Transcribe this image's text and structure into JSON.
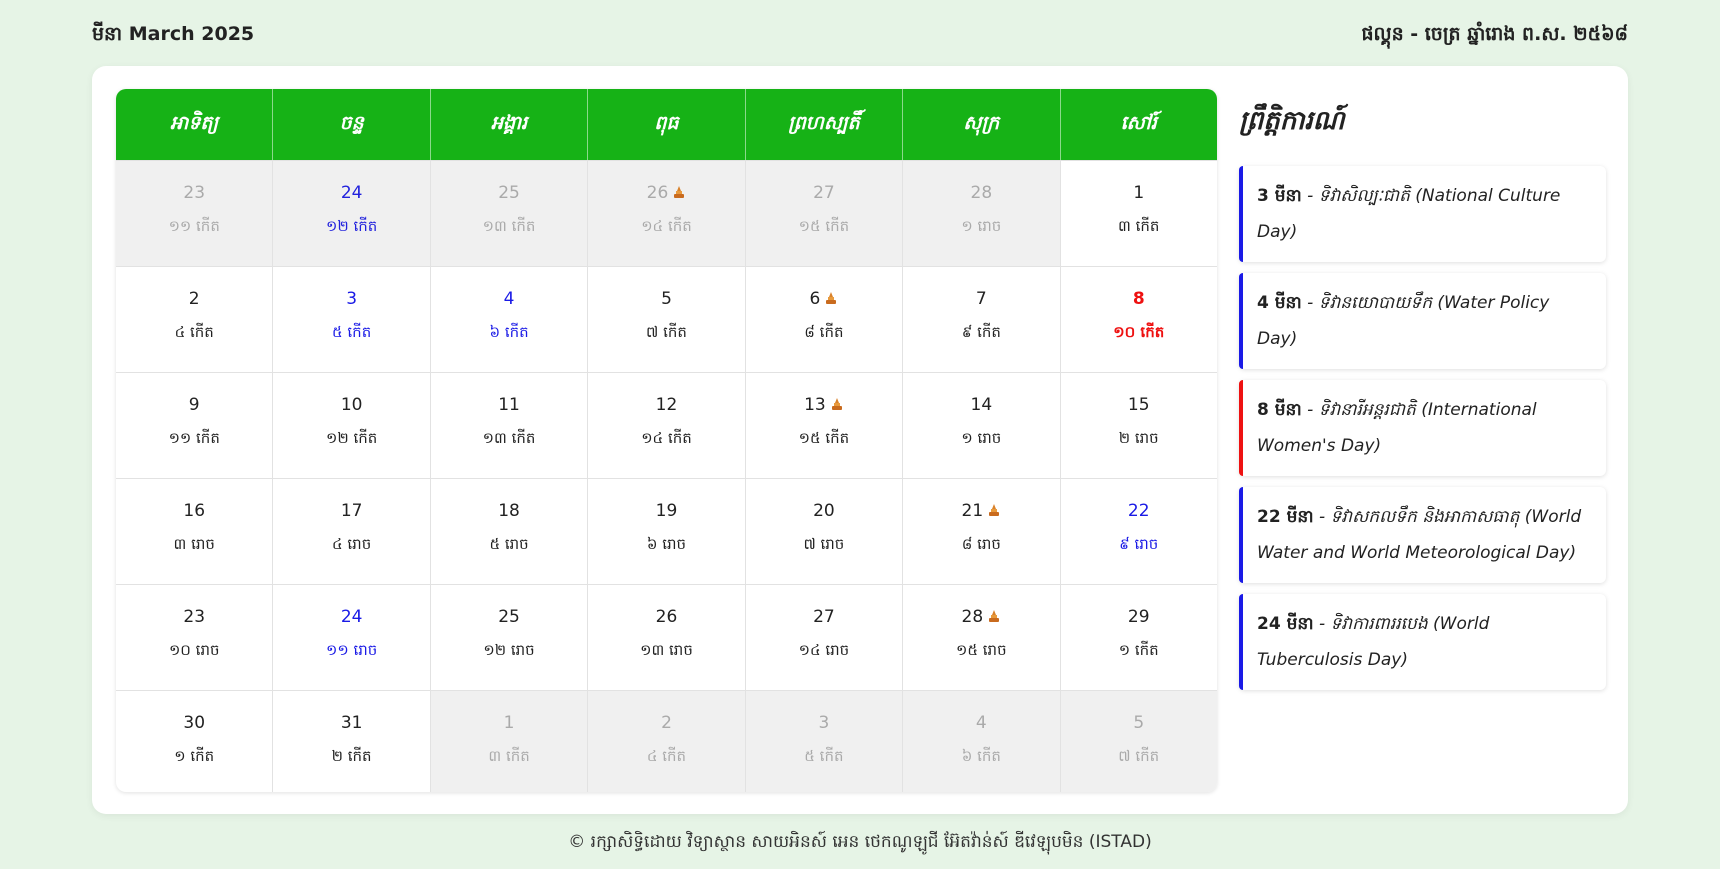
{
  "header": {
    "month_title": "មីនា March 2025",
    "lunar_title": "ផល្គុន - ចេត្រ ឆ្នាំរោង ព.ស. ២៥៦៨"
  },
  "weekdays": [
    "អាទិត្យ",
    "ចន្ទ",
    "អង្គារ",
    "ពុធ",
    "ព្រហស្បតិ៍",
    "សុក្រ",
    "សៅរ៍"
  ],
  "weeks": [
    [
      {
        "day": "23",
        "lunar": "១១ កើត",
        "state": "other"
      },
      {
        "day": "24",
        "lunar": "១២ កើត",
        "state": "other-blue"
      },
      {
        "day": "25",
        "lunar": "១៣ កើត",
        "state": "other"
      },
      {
        "day": "26",
        "lunar": "១៤ កើត",
        "state": "other",
        "holy": true
      },
      {
        "day": "27",
        "lunar": "១៥ កើត",
        "state": "other"
      },
      {
        "day": "28",
        "lunar": "១ រោច",
        "state": "other"
      },
      {
        "day": "1",
        "lunar": "៣ កើត",
        "state": "normal"
      }
    ],
    [
      {
        "day": "2",
        "lunar": "៤ កើត",
        "state": "normal"
      },
      {
        "day": "3",
        "lunar": "៥ កើត",
        "state": "blue"
      },
      {
        "day": "4",
        "lunar": "៦ កើត",
        "state": "blue"
      },
      {
        "day": "5",
        "lunar": "៧ កើត",
        "state": "normal"
      },
      {
        "day": "6",
        "lunar": "៨ កើត",
        "state": "normal",
        "holy": true
      },
      {
        "day": "7",
        "lunar": "៩ កើត",
        "state": "normal"
      },
      {
        "day": "8",
        "lunar": "១០ កើត",
        "state": "red"
      }
    ],
    [
      {
        "day": "9",
        "lunar": "១១ កើត",
        "state": "normal"
      },
      {
        "day": "10",
        "lunar": "១២ កើត",
        "state": "normal"
      },
      {
        "day": "11",
        "lunar": "១៣ កើត",
        "state": "normal"
      },
      {
        "day": "12",
        "lunar": "១៤ កើត",
        "state": "normal"
      },
      {
        "day": "13",
        "lunar": "១៥ កើត",
        "state": "normal",
        "holy": true
      },
      {
        "day": "14",
        "lunar": "១ រោច",
        "state": "normal"
      },
      {
        "day": "15",
        "lunar": "២ រោច",
        "state": "normal"
      }
    ],
    [
      {
        "day": "16",
        "lunar": "៣ រោច",
        "state": "normal"
      },
      {
        "day": "17",
        "lunar": "៤ រោច",
        "state": "normal"
      },
      {
        "day": "18",
        "lunar": "៥ រោច",
        "state": "normal"
      },
      {
        "day": "19",
        "lunar": "៦ រោច",
        "state": "normal"
      },
      {
        "day": "20",
        "lunar": "៧ រោច",
        "state": "normal"
      },
      {
        "day": "21",
        "lunar": "៨ រោច",
        "state": "normal",
        "holy": true
      },
      {
        "day": "22",
        "lunar": "៩ រោច",
        "state": "blue"
      }
    ],
    [
      {
        "day": "23",
        "lunar": "១០ រោច",
        "state": "normal"
      },
      {
        "day": "24",
        "lunar": "១១ រោច",
        "state": "blue"
      },
      {
        "day": "25",
        "lunar": "១២ រោច",
        "state": "normal"
      },
      {
        "day": "26",
        "lunar": "១៣ រោច",
        "state": "normal"
      },
      {
        "day": "27",
        "lunar": "១៤ រោច",
        "state": "normal"
      },
      {
        "day": "28",
        "lunar": "១៥ រោច",
        "state": "normal",
        "holy": true
      },
      {
        "day": "29",
        "lunar": "១ កើត",
        "state": "normal"
      }
    ],
    [
      {
        "day": "30",
        "lunar": "១ កើត",
        "state": "normal"
      },
      {
        "day": "31",
        "lunar": "២ កើត",
        "state": "normal"
      },
      {
        "day": "1",
        "lunar": "៣ កើត",
        "state": "other"
      },
      {
        "day": "2",
        "lunar": "៤ កើត",
        "state": "other"
      },
      {
        "day": "3",
        "lunar": "៥ កើត",
        "state": "other"
      },
      {
        "day": "4",
        "lunar": "៦ កើត",
        "state": "other"
      },
      {
        "day": "5",
        "lunar": "៧ កើត",
        "state": "other"
      }
    ]
  ],
  "holy_day_icon": "stupa-icon",
  "events_panel": {
    "title": "ព្រឹត្តិការណ៍",
    "items": [
      {
        "date": "3 មីនា",
        "text": " - ទិវាសិល្បៈជាតិ (National Culture Day)",
        "color": "#1a1ae6"
      },
      {
        "date": "4 មីនា",
        "text": " - ទិវានយោបាយទឹក (Water Policy Day)",
        "color": "#1a1ae6"
      },
      {
        "date": "8 មីនា",
        "text": " - ទិវានារីអន្តរជាតិ (International Women's Day)",
        "color": "#ee1111"
      },
      {
        "date": "22 មីនា",
        "text": " - ទិវាសកលទឹក និងអាកាសធាតុ (World Water and World Meteorological Day)",
        "color": "#1a1ae6"
      },
      {
        "date": "24 មីនា",
        "text": " - ទិវាការពាររបេង (World Tuberculosis Day)",
        "color": "#1a1ae6"
      }
    ]
  },
  "footer": {
    "text": "© រក្សាសិទ្ធិដោយ វិទ្យាស្ថាន សាយអិនស៍ អេន ថេកណូឡូជី អ៊ែតវ៉ាន់ស៍ ឌីវេឡុបមិន (ISTAD)"
  }
}
